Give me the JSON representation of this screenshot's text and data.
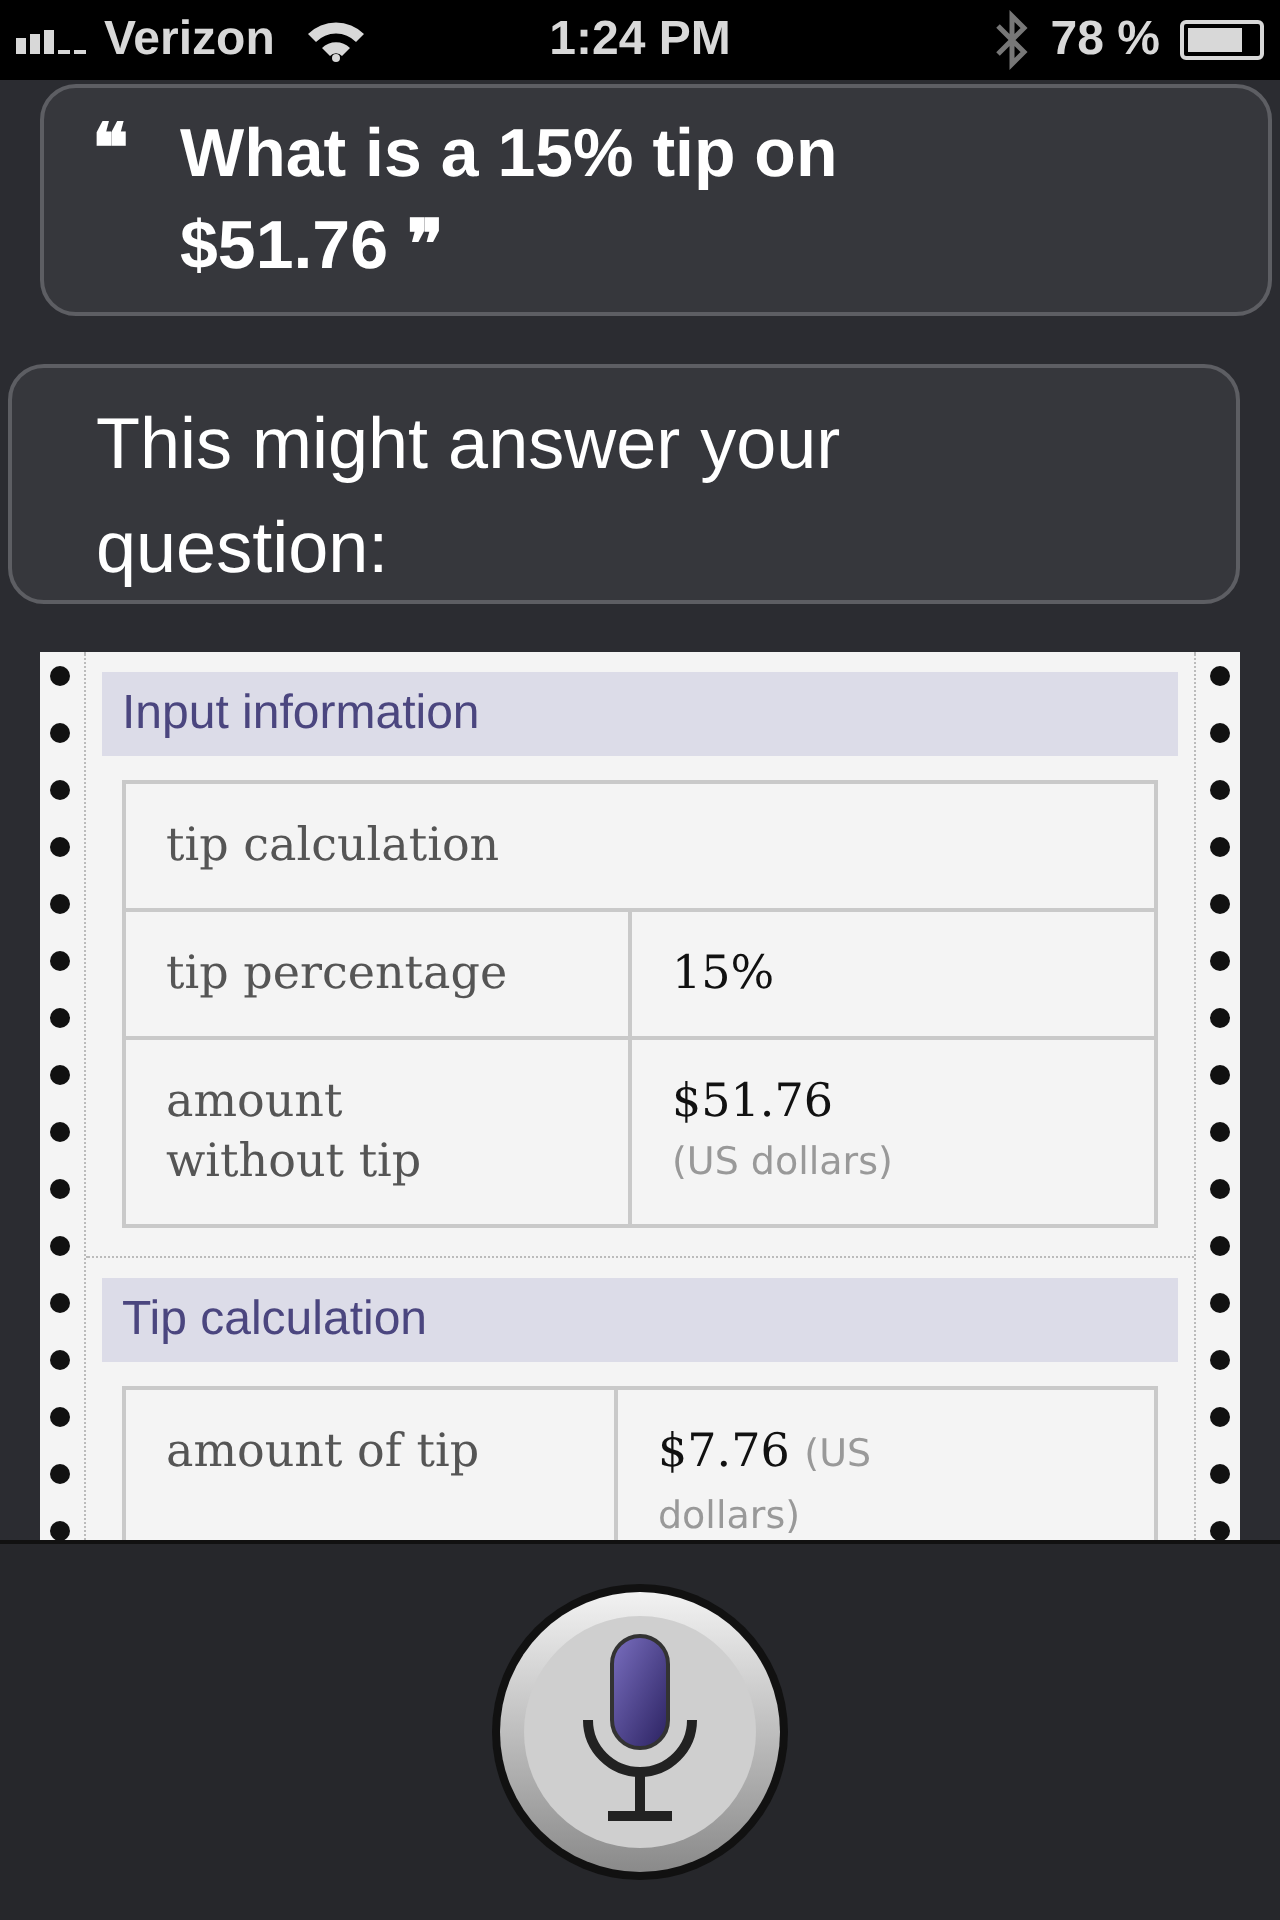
{
  "status_bar": {
    "carrier": "Verizon",
    "time": "1:24 PM",
    "battery": "78 %",
    "battery_gauge": {
      "level": 0.78
    }
  },
  "user_query": {
    "open_mark": "❝",
    "text": "What is a 15% tip on $51.76 ❞"
  },
  "siri_reply": {
    "text": "This might answer your question:"
  },
  "result_card": {
    "sections": [
      {
        "title": "Input information",
        "rows": [
          {
            "kind": "header",
            "label": "tip calculation"
          },
          {
            "kind": "pair",
            "label": "tip percentage",
            "value": "15%"
          },
          {
            "kind": "pair",
            "label": "amount without tip",
            "value": "$51.76",
            "unit": "(US dollars)"
          }
        ]
      },
      {
        "title": "Tip calculation",
        "rows": [
          {
            "kind": "pair_inline",
            "label": "amount of tip",
            "value": "$7.76",
            "unit": "(US dollars)"
          }
        ]
      }
    ]
  }
}
